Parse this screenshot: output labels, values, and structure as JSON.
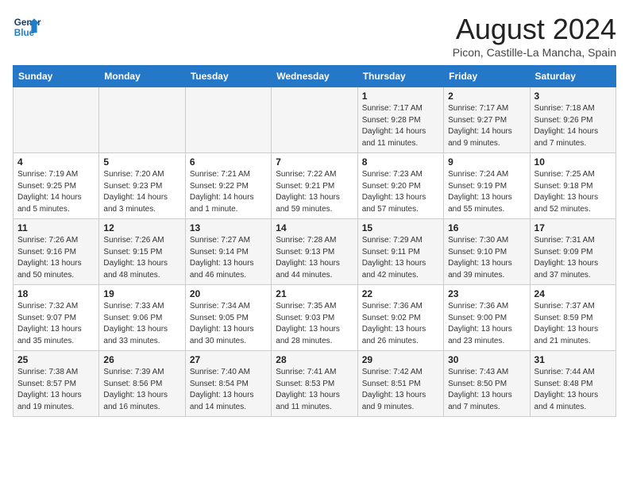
{
  "header": {
    "logo_line1": "General",
    "logo_line2": "Blue",
    "month_year": "August 2024",
    "location": "Picon, Castille-La Mancha, Spain"
  },
  "weekdays": [
    "Sunday",
    "Monday",
    "Tuesday",
    "Wednesday",
    "Thursday",
    "Friday",
    "Saturday"
  ],
  "weeks": [
    [
      {
        "day": "",
        "info": ""
      },
      {
        "day": "",
        "info": ""
      },
      {
        "day": "",
        "info": ""
      },
      {
        "day": "",
        "info": ""
      },
      {
        "day": "1",
        "info": "Sunrise: 7:17 AM\nSunset: 9:28 PM\nDaylight: 14 hours\nand 11 minutes."
      },
      {
        "day": "2",
        "info": "Sunrise: 7:17 AM\nSunset: 9:27 PM\nDaylight: 14 hours\nand 9 minutes."
      },
      {
        "day": "3",
        "info": "Sunrise: 7:18 AM\nSunset: 9:26 PM\nDaylight: 14 hours\nand 7 minutes."
      }
    ],
    [
      {
        "day": "4",
        "info": "Sunrise: 7:19 AM\nSunset: 9:25 PM\nDaylight: 14 hours\nand 5 minutes."
      },
      {
        "day": "5",
        "info": "Sunrise: 7:20 AM\nSunset: 9:23 PM\nDaylight: 14 hours\nand 3 minutes."
      },
      {
        "day": "6",
        "info": "Sunrise: 7:21 AM\nSunset: 9:22 PM\nDaylight: 14 hours\nand 1 minute."
      },
      {
        "day": "7",
        "info": "Sunrise: 7:22 AM\nSunset: 9:21 PM\nDaylight: 13 hours\nand 59 minutes."
      },
      {
        "day": "8",
        "info": "Sunrise: 7:23 AM\nSunset: 9:20 PM\nDaylight: 13 hours\nand 57 minutes."
      },
      {
        "day": "9",
        "info": "Sunrise: 7:24 AM\nSunset: 9:19 PM\nDaylight: 13 hours\nand 55 minutes."
      },
      {
        "day": "10",
        "info": "Sunrise: 7:25 AM\nSunset: 9:18 PM\nDaylight: 13 hours\nand 52 minutes."
      }
    ],
    [
      {
        "day": "11",
        "info": "Sunrise: 7:26 AM\nSunset: 9:16 PM\nDaylight: 13 hours\nand 50 minutes."
      },
      {
        "day": "12",
        "info": "Sunrise: 7:26 AM\nSunset: 9:15 PM\nDaylight: 13 hours\nand 48 minutes."
      },
      {
        "day": "13",
        "info": "Sunrise: 7:27 AM\nSunset: 9:14 PM\nDaylight: 13 hours\nand 46 minutes."
      },
      {
        "day": "14",
        "info": "Sunrise: 7:28 AM\nSunset: 9:13 PM\nDaylight: 13 hours\nand 44 minutes."
      },
      {
        "day": "15",
        "info": "Sunrise: 7:29 AM\nSunset: 9:11 PM\nDaylight: 13 hours\nand 42 minutes."
      },
      {
        "day": "16",
        "info": "Sunrise: 7:30 AM\nSunset: 9:10 PM\nDaylight: 13 hours\nand 39 minutes."
      },
      {
        "day": "17",
        "info": "Sunrise: 7:31 AM\nSunset: 9:09 PM\nDaylight: 13 hours\nand 37 minutes."
      }
    ],
    [
      {
        "day": "18",
        "info": "Sunrise: 7:32 AM\nSunset: 9:07 PM\nDaylight: 13 hours\nand 35 minutes."
      },
      {
        "day": "19",
        "info": "Sunrise: 7:33 AM\nSunset: 9:06 PM\nDaylight: 13 hours\nand 33 minutes."
      },
      {
        "day": "20",
        "info": "Sunrise: 7:34 AM\nSunset: 9:05 PM\nDaylight: 13 hours\nand 30 minutes."
      },
      {
        "day": "21",
        "info": "Sunrise: 7:35 AM\nSunset: 9:03 PM\nDaylight: 13 hours\nand 28 minutes."
      },
      {
        "day": "22",
        "info": "Sunrise: 7:36 AM\nSunset: 9:02 PM\nDaylight: 13 hours\nand 26 minutes."
      },
      {
        "day": "23",
        "info": "Sunrise: 7:36 AM\nSunset: 9:00 PM\nDaylight: 13 hours\nand 23 minutes."
      },
      {
        "day": "24",
        "info": "Sunrise: 7:37 AM\nSunset: 8:59 PM\nDaylight: 13 hours\nand 21 minutes."
      }
    ],
    [
      {
        "day": "25",
        "info": "Sunrise: 7:38 AM\nSunset: 8:57 PM\nDaylight: 13 hours\nand 19 minutes."
      },
      {
        "day": "26",
        "info": "Sunrise: 7:39 AM\nSunset: 8:56 PM\nDaylight: 13 hours\nand 16 minutes."
      },
      {
        "day": "27",
        "info": "Sunrise: 7:40 AM\nSunset: 8:54 PM\nDaylight: 13 hours\nand 14 minutes."
      },
      {
        "day": "28",
        "info": "Sunrise: 7:41 AM\nSunset: 8:53 PM\nDaylight: 13 hours\nand 11 minutes."
      },
      {
        "day": "29",
        "info": "Sunrise: 7:42 AM\nSunset: 8:51 PM\nDaylight: 13 hours\nand 9 minutes."
      },
      {
        "day": "30",
        "info": "Sunrise: 7:43 AM\nSunset: 8:50 PM\nDaylight: 13 hours\nand 7 minutes."
      },
      {
        "day": "31",
        "info": "Sunrise: 7:44 AM\nSunset: 8:48 PM\nDaylight: 13 hours\nand 4 minutes."
      }
    ]
  ]
}
